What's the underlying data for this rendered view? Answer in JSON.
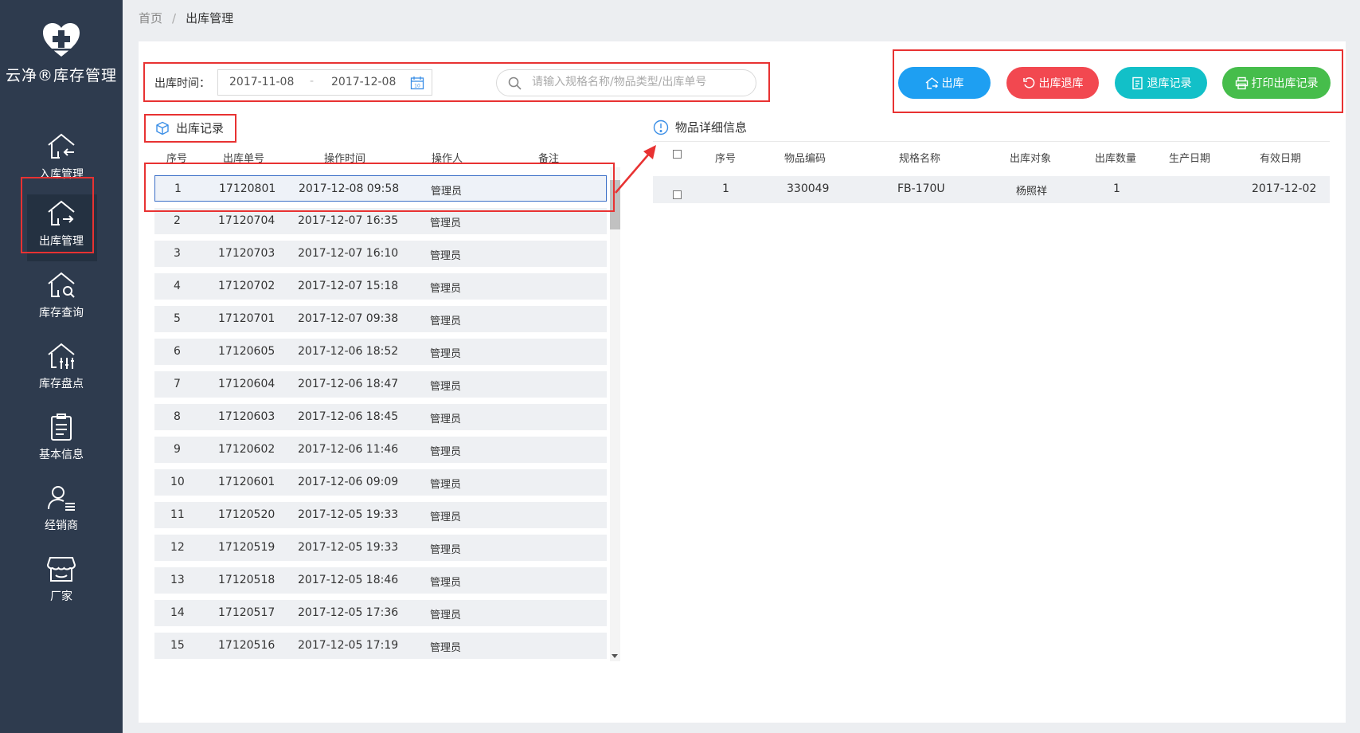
{
  "app": {
    "name": "云净®库存管理"
  },
  "sidebar": {
    "items": [
      {
        "label": "入库管理",
        "icon": "house-in-icon"
      },
      {
        "label": "出库管理",
        "icon": "house-out-icon"
      },
      {
        "label": "库存查询",
        "icon": "house-search-icon"
      },
      {
        "label": "库存盘点",
        "icon": "house-sliders-icon"
      },
      {
        "label": "基本信息",
        "icon": "clipboard-icon"
      },
      {
        "label": "经销商",
        "icon": "user-list-icon"
      },
      {
        "label": "厂家",
        "icon": "store-icon"
      }
    ]
  },
  "breadcrumb": {
    "home": "首页",
    "separator": "/",
    "current": "出库管理"
  },
  "filter": {
    "label": "出库时间：",
    "start_date": "2017-11-08",
    "end_date": "2017-12-08",
    "search_placeholder": "请输入规格名称/物品类型/出库单号"
  },
  "actions": {
    "out": "出库",
    "out_return": "出库退库",
    "return_record": "退库记录",
    "print_record": "打印出库记录"
  },
  "colors": {
    "blue": "#1e9ff2",
    "red": "#f24850",
    "teal": "#12c0c8",
    "green": "#46bd4b",
    "sidebar": "#2e3b4e"
  },
  "records": {
    "title": "出库记录",
    "columns": [
      "序号",
      "出库单号",
      "操作时间",
      "操作人",
      "备注"
    ],
    "rows": [
      {
        "idx": "1",
        "no": "17120801",
        "time": "2017-12-08 09:58",
        "op": "管理员"
      },
      {
        "idx": "2",
        "no": "17120704",
        "time": "2017-12-07 16:35",
        "op": "管理员"
      },
      {
        "idx": "3",
        "no": "17120703",
        "time": "2017-12-07 16:10",
        "op": "管理员"
      },
      {
        "idx": "4",
        "no": "17120702",
        "time": "2017-12-07 15:18",
        "op": "管理员"
      },
      {
        "idx": "5",
        "no": "17120701",
        "time": "2017-12-07 09:38",
        "op": "管理员"
      },
      {
        "idx": "6",
        "no": "17120605",
        "time": "2017-12-06 18:52",
        "op": "管理员"
      },
      {
        "idx": "7",
        "no": "17120604",
        "time": "2017-12-06 18:47",
        "op": "管理员"
      },
      {
        "idx": "8",
        "no": "17120603",
        "time": "2017-12-06 18:45",
        "op": "管理员"
      },
      {
        "idx": "9",
        "no": "17120602",
        "time": "2017-12-06 11:46",
        "op": "管理员"
      },
      {
        "idx": "10",
        "no": "17120601",
        "time": "2017-12-06 09:09",
        "op": "管理员"
      },
      {
        "idx": "11",
        "no": "17120520",
        "time": "2017-12-05 19:33",
        "op": "管理员"
      },
      {
        "idx": "12",
        "no": "17120519",
        "time": "2017-12-05 19:33",
        "op": "管理员"
      },
      {
        "idx": "13",
        "no": "17120518",
        "time": "2017-12-05 18:46",
        "op": "管理员"
      },
      {
        "idx": "14",
        "no": "17120517",
        "time": "2017-12-05 17:36",
        "op": "管理员"
      },
      {
        "idx": "15",
        "no": "17120516",
        "time": "2017-12-05 17:19",
        "op": "管理员"
      }
    ]
  },
  "details": {
    "title": "物品详细信息",
    "columns": [
      "序号",
      "物品编码",
      "规格名称",
      "出库对象",
      "出库数量",
      "生产日期",
      "有效日期"
    ],
    "rows": [
      {
        "idx": "1",
        "code": "330049",
        "spec": "FB-170U",
        "target": "杨照祥",
        "qty": "1",
        "prod_date": "",
        "exp_date": "2017-12-02"
      }
    ]
  }
}
